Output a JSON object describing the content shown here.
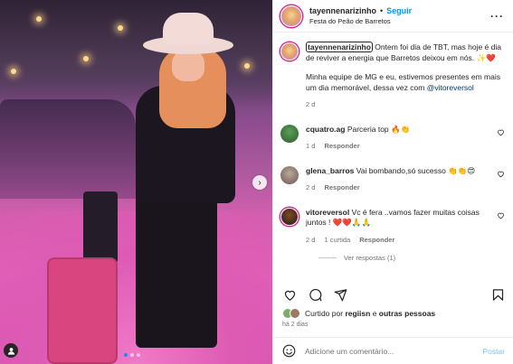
{
  "post": {
    "username": "tayennenarizinho",
    "follow_label": "Seguir",
    "separator": "•",
    "location": "Festa do Peão de Barretos",
    "more_icon": "more-horizontal-icon"
  },
  "caption": {
    "username": "tayennenarizinho",
    "text_1": "Ontem foi dia de TBT, mas hoje é dia de reviver a energia que Barretos deixou em nós. ✨❤️",
    "text_2": "Minha equipe de MG e eu, estivemos presentes em mais um dia memorável, dessa vez com",
    "mention": "@vitoreversol",
    "age": "2 d"
  },
  "comments": [
    {
      "username": "cquatro.ag",
      "text": "Parceria top 🔥👏",
      "age": "1 d",
      "reply_label": "Responder",
      "likes": ""
    },
    {
      "username": "glena_barros",
      "text": "Vai bombando,só sucesso 👏👏😍",
      "age": "2 d",
      "reply_label": "Responder",
      "likes": ""
    },
    {
      "username": "vitoreversol",
      "text": "Vc é fera ..vamos fazer muitas coisas juntos ! ❤️❤️🙏🙏",
      "age": "2 d",
      "likes": "1 curtida",
      "reply_label": "Responder"
    }
  ],
  "view_replies": "Ver respostas (1)",
  "likes": {
    "prefix": "Curtido por",
    "user": "regiisn",
    "middle": "e",
    "others": "outras pessoas"
  },
  "time_ago": "há 2 dias",
  "add_comment": {
    "placeholder": "Adicione um comentário...",
    "post_label": "Postar"
  },
  "colors": {
    "accent": "#0095f6",
    "text": "#262626",
    "muted": "#737373",
    "heart": "#ed4956"
  }
}
